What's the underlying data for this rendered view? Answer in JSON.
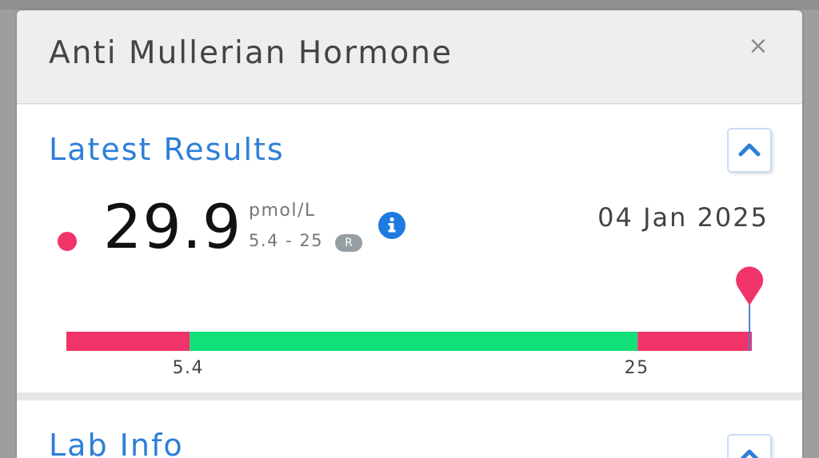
{
  "modal": {
    "title": "Anti Mullerian Hormone",
    "close_label": "×"
  },
  "latest_results": {
    "title": "Latest Results",
    "value": "29.9",
    "unit": "pmol/L",
    "range": "5.4 - 25",
    "range_badge": "R",
    "date": "04 Jan 2025",
    "status_color": "#f0346a"
  },
  "range_bar": {
    "min": 0,
    "max": 30,
    "low_threshold": 5.4,
    "high_threshold": 25,
    "low_label": "5.4",
    "high_label": "25",
    "marker_value": 29.9,
    "colors": {
      "out_of_range": "#f0346a",
      "in_range": "#11e078",
      "marker_line": "#4a7bd6"
    }
  },
  "lab_info": {
    "title": "Lab Info"
  },
  "colors": {
    "accent": "#2e7fd8"
  },
  "icons": {
    "close": "close-icon",
    "collapse": "chevron-up-icon",
    "info": "info-icon"
  }
}
